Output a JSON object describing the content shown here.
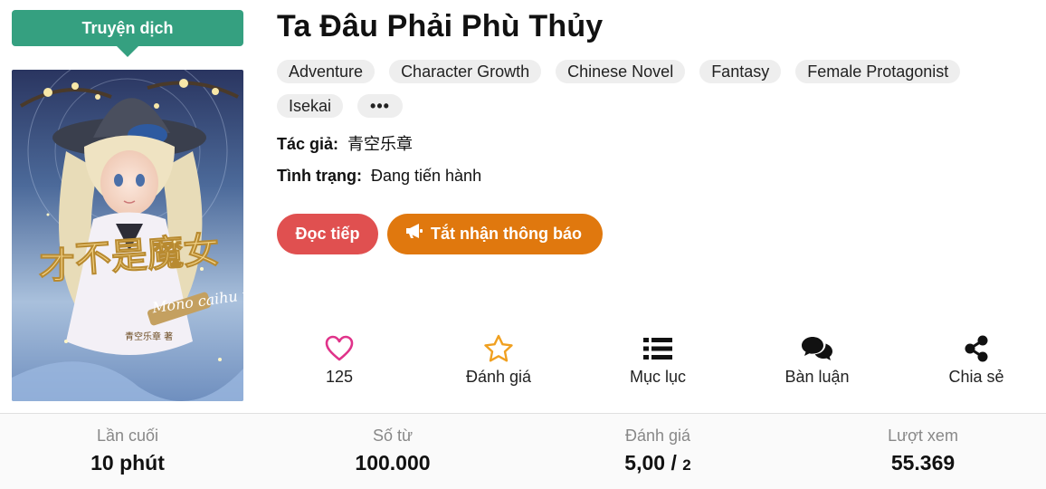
{
  "badge": {
    "label": "Truyện dịch"
  },
  "novel": {
    "title": "Ta Đâu Phải Phù Thủy",
    "tags": [
      "Adventure",
      "Character Growth",
      "Chinese Novel",
      "Fantasy",
      "Female Protagonist",
      "Isekai"
    ],
    "more_tags_label": "•••",
    "author_label": "Tác giả:",
    "author": "青空乐章",
    "status_label": "Tình trạng:",
    "status": "Đang tiến hành"
  },
  "cover": {
    "title_text": "不是魔女",
    "extra_char": "才",
    "subtitle_text": "Mono caihu thi",
    "author_text": "青空乐章 著"
  },
  "buttons": {
    "read_label": "Đọc tiếp",
    "notify_label": "Tắt nhận thông báo"
  },
  "actions": [
    {
      "icon": "heart-icon",
      "label": "125"
    },
    {
      "icon": "star-icon",
      "label": "Đánh giá"
    },
    {
      "icon": "list-icon",
      "label": "Mục lục"
    },
    {
      "icon": "comments-icon",
      "label": "Bàn luận"
    },
    {
      "icon": "share-icon",
      "label": "Chia sẻ"
    }
  ],
  "stats": [
    {
      "label": "Lần cuối",
      "value": "10 phút"
    },
    {
      "label": "Số từ",
      "value": "100.000"
    },
    {
      "label": "Đánh giá",
      "value": "5,00 /",
      "suffix": "2"
    },
    {
      "label": "Lượt xem",
      "value": "55.369"
    }
  ],
  "colors": {
    "badge": "#35a080",
    "read_button": "#e05050",
    "notify_button": "#e0780e",
    "heart": "#e0338a",
    "star": "#f0a020"
  }
}
